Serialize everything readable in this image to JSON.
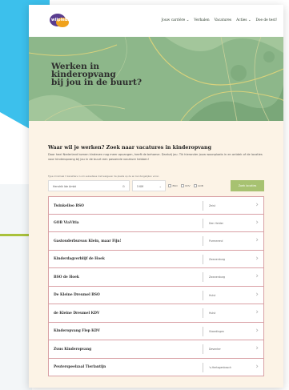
{
  "header": {
    "logo_text": "wilpiedie",
    "nav": [
      "Jouw carrière ⌄",
      "Verhalen",
      "Vacatures",
      "Acties ⌄",
      "Doe de test!"
    ]
  },
  "hero": {
    "title": "Werken in\nkinderopvang\nbij jou in de buurt?"
  },
  "main": {
    "heading": "Waar wil je werken? Zoek naar vacatures in kinderopvang",
    "intro": "Door heel Nederland komen kindeven nog meer opvangen, heeft de behoeve. Dankzij jou. Tik hieronder jouw woonplaats in en ontdek of de locaties voor kinderopvang bij jou in de buurt een passende vacature hebben!",
    "tip": "Type minimaal 3 karakters in om suksetsies met welgever de plaats op de en bel dergelijken vorsn",
    "search": {
      "location_value": "Hendrik Ide Ambt",
      "distance_value": "5 KM",
      "checkbox_labels": [
        "BSO",
        "KDV",
        "GOB"
      ],
      "button_label": "Zoek locaties"
    },
    "results": [
      {
        "name": "Twinkelloo BSO",
        "city": "Zeist"
      },
      {
        "name": "GOB ViaVitia",
        "city": "Den Helder"
      },
      {
        "name": "Gastouderbureau Klein, maar Fijn!",
        "city": "Purmerend"
      },
      {
        "name": "Kinderdagverblijf de Hoek",
        "city": "Zwanenburg"
      },
      {
        "name": "BSO de Hoek",
        "city": "Zwanenburg"
      },
      {
        "name": "De Kleine Dreumel BSO",
        "city": "Hulst"
      },
      {
        "name": "de Kleine Dreumel KDV",
        "city": "Hulst"
      },
      {
        "name": "Kinderopvang Flep KDV",
        "city": "Vlaardingen"
      },
      {
        "name": "Zuus Kinderopvang",
        "city": "Deventer"
      },
      {
        "name": "Peuterspeelzaal Tierlantijn",
        "city": "'s-Hertogenbosch"
      }
    ]
  },
  "colors": {
    "accent_blue": "#3cc0ec",
    "hero_green": "#8db78a",
    "button_green": "#a7c271",
    "cream": "#fcf3e6",
    "row_border": "#d9a0a5"
  }
}
